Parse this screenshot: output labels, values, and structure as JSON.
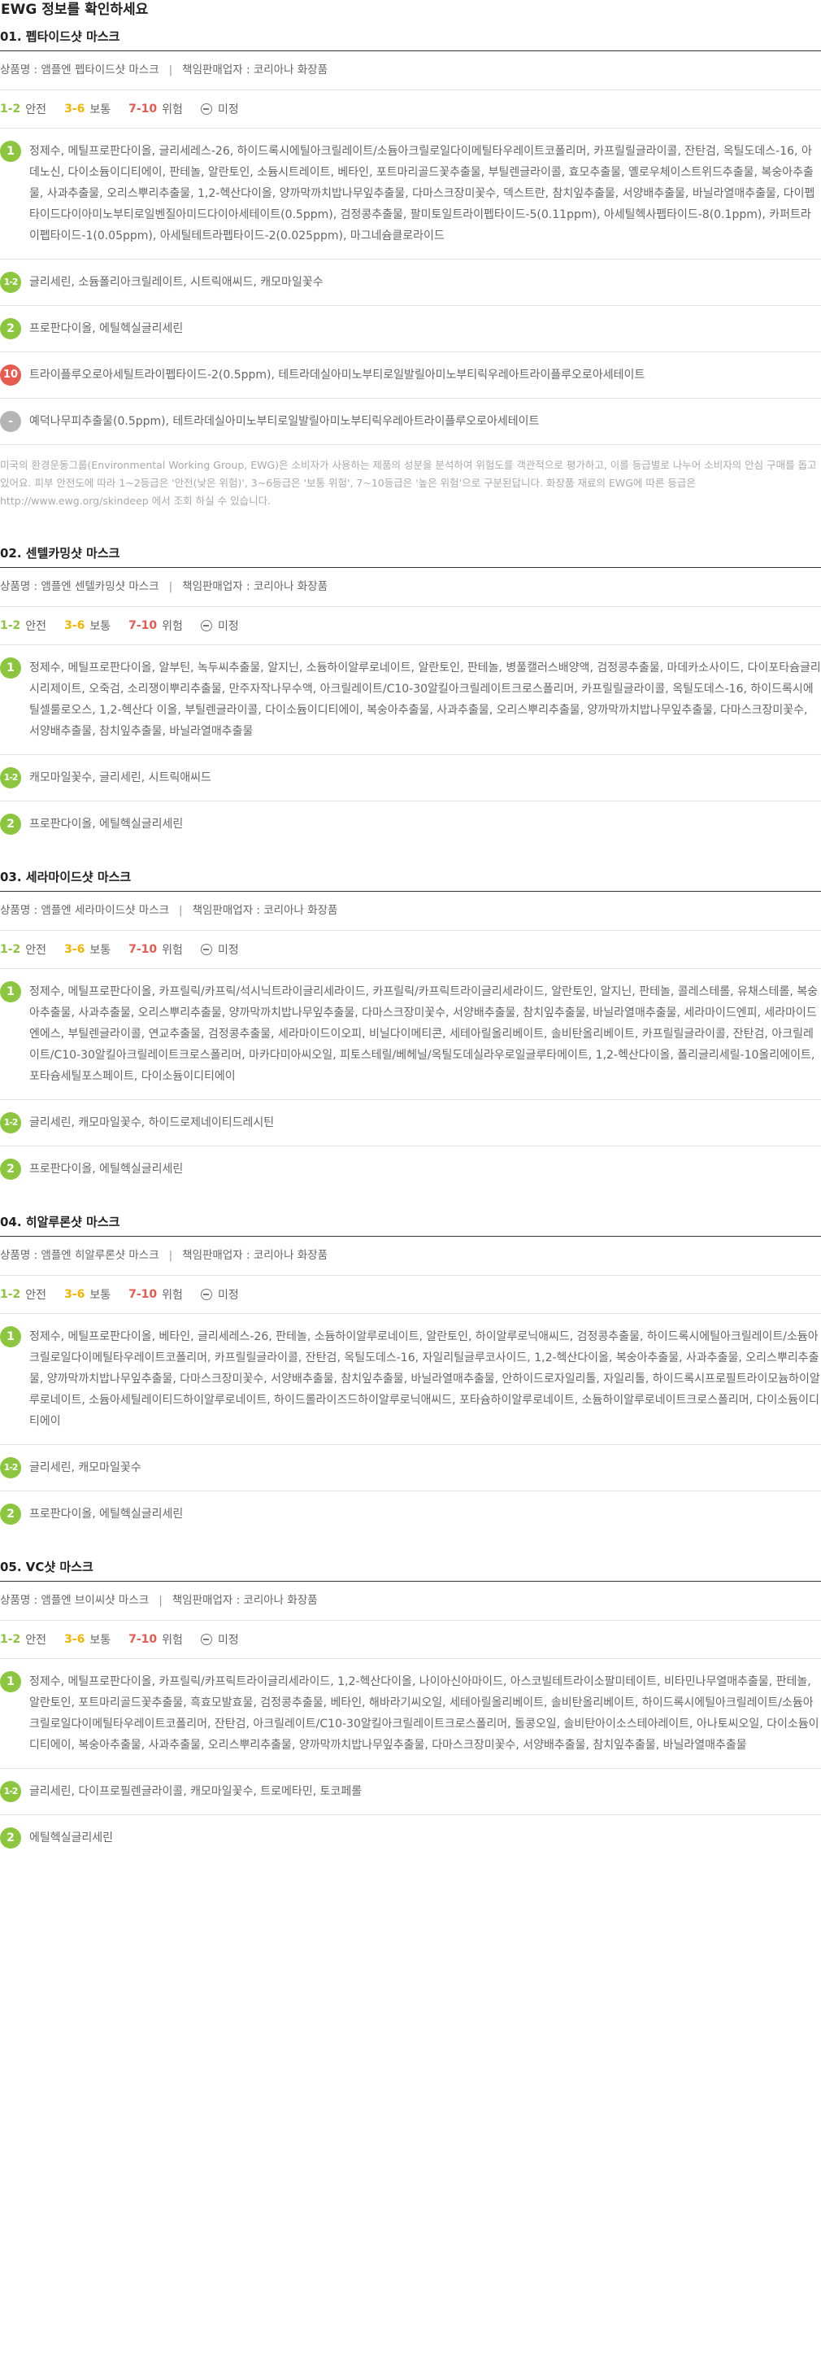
{
  "page_title": "EWG 정보를 확인하세요",
  "labels": {
    "product_name_prefix": "상품명 : ",
    "seller_prefix": "책임판매업자 : ",
    "separator": "|"
  },
  "legend": {
    "safe_range": "1-2",
    "safe_label": "안전",
    "mid_range": "3-6",
    "mid_label": "보통",
    "high_range": "7-10",
    "high_label": "위험",
    "none_label": "미정",
    "colors": {
      "safe": "#8cc63f",
      "mid": "#f4b400",
      "high": "#e8594f",
      "none": "#b5b5b5"
    }
  },
  "products": [
    {
      "title": "01. 펩타이드샷 마스크",
      "product_name": "앰플엔 펩타이드샷 마스크",
      "seller": "코리아나 화장품",
      "grades": [
        {
          "badge": "1",
          "level": "safe",
          "text": "정제수, 메틸프로판다이올, 글리세레스-26, 하이드록시에틸아크릴레이트/소듐아크릴로일다이메틸타우레이트코폴리머, 카프릴릴글라이콜, 잔탄검, 옥틸도데스-16, 아데노신, 다이소듐이디티에이, 판테놀, 알란토인, 소듐시트레이트, 베타인, 포트마리골드꽃추출물, 부틸렌글라이콜, 효모추출물, 옐로우체이스트위드추출물, 복숭아추출물, 사과추출물, 오리스뿌리추출물, 1,2-헥산다이올, 양까막까치밥나무잎추출물, 다마스크장미꽃수, 덱스트란, 참치잎추출물, 서양배추출물, 바닐라열매추출물, 다이펩타이드다이아미노부티로일벤질아미드다이아세테이트(0.5ppm), 검정콩추출물, 팔미토일트라이펩타이드-5(0.11ppm), 아세틸헥사펩타이드-8(0.1ppm), 카퍼트라이펩타이드-1(0.05ppm), 아세틸테트라펩타이드-2(0.025ppm), 마그네슘클로라이드"
        },
        {
          "badge": "1-2",
          "level": "safe",
          "text": "글리세린, 소듐폴리아크릴레이트, 시트릭애씨드, 캐모마일꽃수"
        },
        {
          "badge": "2",
          "level": "safe",
          "text": "프로판다이올, 에틸헥실글리세린"
        },
        {
          "badge": "10",
          "level": "high",
          "text": "트라이플루오로아세틸트라이펩타이드-2(0.5ppm), 테트라데실아미노부티로일발릴아미노부티릭우레아트라이플루오로아세테이트"
        },
        {
          "badge": "-",
          "level": "none",
          "text": "예덕나무피추출물(0.5ppm), 테트라데실아미노부티로일발릴아미노부티릭우레아트라이플루오로아세테이트"
        }
      ],
      "note": "미국의 환경운동그룹(Environmental Working Group, EWG)은 소비자가 사용하는 제품의 성분을 분석하여 위험도를 객관적으로 평가하고, 이를 등급별로 나누어 소비자의 안심 구매를 돕고 있어요. 피부 안전도에 따라 1~2등급은 '안전(낮은 위험)', 3~6등급은 '보통 위험', 7~10등급은 '높은 위험'으로 구분된답니다. 화장품 재료의 EWG에 따른 등급은 http://www.ewg.org/skindeep 에서 조회 하실 수 있습니다."
    },
    {
      "title": "02. 센텔카밍샷 마스크",
      "product_name": "앰플엔 센텔카밍샷 마스크",
      "seller": "코리아나 화장품",
      "grades": [
        {
          "badge": "1",
          "level": "safe",
          "text": "정제수, 메틸프로판다이올, 알부틴, 녹두씨추출물, 알지닌, 소듐하이알루로네이트, 알란토인, 판테놀, 병풀캘러스배양액, 검정콩추출물, 마데카소사이드, 다이포타슘글리시리제이트, 오죽검, 소리쟁이뿌리추출물, 만주자작나무수액, 아크릴레이트/C10-30알킬아크릴레이트크로스폴리머, 카프릴릴글라이콜, 옥틸도데스-16, 하이드록시에틸셀룰로오스, 1,2-헥산다 이올, 부틸렌글라이콜, 다이소듐이디티에이, 복숭아추출물, 사과추출물, 오리스뿌리추출물, 양까막까치밥나무잎추출물, 다마스크장미꽃수, 서양배추출물, 참치잎추출물, 바닐라열매추출물"
        },
        {
          "badge": "1-2",
          "level": "safe",
          "text": "캐모마일꽃수, 글리세린, 시트릭애씨드"
        },
        {
          "badge": "2",
          "level": "safe",
          "text": "프로판다이올, 에틸헥실글리세린"
        }
      ]
    },
    {
      "title": "03. 세라마이드샷 마스크",
      "product_name": "앰플엔 세라마이드샷 마스크",
      "seller": "코리아나 화장품",
      "grades": [
        {
          "badge": "1",
          "level": "safe",
          "text": "정제수, 메틸프로판다이올, 카프릴릭/카프릭/석시닉트라이글리세라이드, 카프릴릭/카프릭트라이글리세라이드, 알란토인, 알지닌, 판테놀, 콜레스테롤, 유채스테롤, 복숭아추출물, 사과추출물, 오리스뿌리추출물, 양까막까치밥나무잎추출물, 다마스크장미꽃수, 서양배추출물, 참치잎추출물, 바닐라열매추출물, 세라마이드엔피, 세라마이드엔에스, 부틸렌글라이콜, 연교추출물, 검정콩추출물, 세라마이드이오피, 비닐다이메티콘, 세테아릴올리베이트, 솔비탄올리베이트, 카프릴릴글라이콜, 잔탄검, 아크릴레이트/C10-30알킬아크릴레이트크로스폴리머, 마카다미아씨오일, 피토스테릴/베헤닐/옥틸도데실라우로일글루타메이트, 1,2-헥산다이올, 폴리글리세릴-10올리에이트, 포타슘세틸포스페이트, 다이소듐이디티에이"
        },
        {
          "badge": "1-2",
          "level": "safe",
          "text": "글리세린, 캐모마일꽃수, 하이드로제네이티드레시틴"
        },
        {
          "badge": "2",
          "level": "safe",
          "text": "프로판다이올, 에틸헥실글리세린"
        }
      ]
    },
    {
      "title": "04. 히알루론샷 마스크",
      "product_name": "앰플엔 히알루론샷 마스크",
      "seller": "코리아나 화장품",
      "grades": [
        {
          "badge": "1",
          "level": "safe",
          "text": "정제수, 메틸프로판다이올, 베타인, 글리세레스-26, 판테놀, 소듐하이알루로네이트, 알란토인, 하이알루로닉애씨드, 검정콩추출물, 하이드록시에틸아크릴레이트/소듐아크릴로일다이메틸타우레이트코폴리머, 카프릴릴글라이콜, 잔탄검, 옥틸도데스-16, 자일리틸글루코사이드, 1,2-헥산다이올, 복숭아추출물, 사과추출물, 오리스뿌리추출물, 양까막까치밥나무잎추출물, 다마스크장미꽃수, 서양배추출물, 참치잎추출물, 바닐라열매추출물, 안하이드로자일리톨, 자일리톨, 하이드록시프로필트라이모늄하이알루로네이트, 소듐아세틸레이티드하이알루로네이트, 하이드롤라이즈드하이알루로닉애씨드, 포타슘하이알루로네이트, 소듐하이알루로네이트크로스폴리머, 다이소듐이디티에이"
        },
        {
          "badge": "1-2",
          "level": "safe",
          "text": "글리세린, 캐모마일꽃수"
        },
        {
          "badge": "2",
          "level": "safe",
          "text": "프로판다이올, 에틸헥실글리세린"
        }
      ]
    },
    {
      "title": "05. VC샷 마스크",
      "product_name": "앰플엔 브이씨샷 마스크",
      "seller": "코리아나 화장품",
      "grades": [
        {
          "badge": "1",
          "level": "safe",
          "text": "정제수, 메틸프로판다이올, 카프릴릭/카프릭트라이글리세라이드, 1,2-헥산다이올, 나이아신아마이드, 아스코빌테트라이소팔미테이트, 비타민나무열매추출물, 판테놀, 알란토인, 포트마리골드꽃추출물, 흑효모발효물, 검정콩추출물, 베타인, 해바라기씨오일, 세테아릴올리베이트, 솔비탄올리베이트, 하이드록시에틸아크릴레이트/소듐아크릴로일다이메틸타우레이트코폴리머, 잔탄검, 아크릴레이트/C10-30알킬아크릴레이트크로스폴리머, 돌콩오일, 솔비탄아이소스테아레이트, 아나토씨오일, 다이소듐이디티에이, 복숭아추출물, 사과추출물, 오리스뿌리추출물, 양까막까치밥나무잎추출물, 다마스크장미꽃수, 서양배추출물, 참치잎추출물, 바닐라열매추출물"
        },
        {
          "badge": "1-2",
          "level": "safe",
          "text": "글리세린, 다이프로필렌글라이콜, 캐모마일꽃수, 트로메타민, 토코페롤"
        },
        {
          "badge": "2",
          "level": "safe",
          "text": "에틸헥실글리세린"
        }
      ]
    }
  ]
}
